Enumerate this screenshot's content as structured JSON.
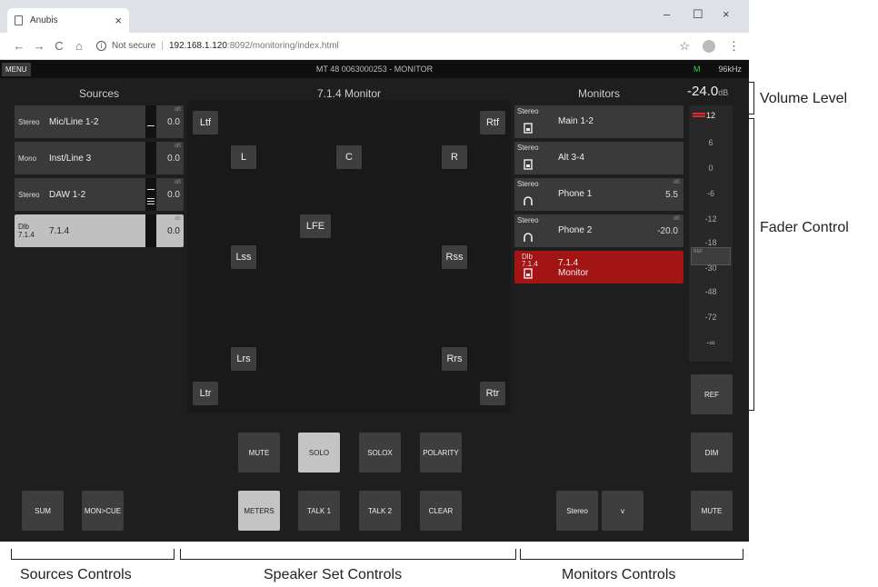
{
  "browser": {
    "tab_title": "Anubis",
    "tab_close": "×",
    "window_controls": [
      "–",
      "☐",
      "×"
    ],
    "nav": [
      "←",
      "→",
      "C",
      "⌂"
    ],
    "security_text": "Not secure",
    "url_host": "192.168.1.120",
    "url_path": ":8092/monitoring/index.html",
    "star_icon": "☆",
    "menu_icon": "⋮"
  },
  "app": {
    "menu_label": "MENU",
    "title": "MT 48 0063000253 - MONITOR",
    "m_indicator": "M",
    "sample_rate": "96kHz",
    "sources_header": "Sources",
    "speaker_header": "7.1.4 Monitor",
    "monitors_header": "Monitors",
    "volume_value": "-24.0",
    "volume_unit": "dB",
    "db_tag": "dB",
    "sources": [
      {
        "kind": "Stereo",
        "name": "Mic/Line 1-2",
        "value": "0.0"
      },
      {
        "kind": "Mono",
        "name": "Inst/Line 3",
        "value": "0.0"
      },
      {
        "kind": "Stereo",
        "name": "DAW 1-2",
        "value": "0.0"
      },
      {
        "kind_line1": "Dlb",
        "kind_line2": "7.1.4",
        "name": "7.1.4",
        "value": "0.0"
      }
    ],
    "speakers": {
      "ltf": "Ltf",
      "rtf": "Rtf",
      "l": "L",
      "c": "C",
      "r": "R",
      "lfe": "LFE",
      "lss": "Lss",
      "rss": "Rss",
      "lrs": "Lrs",
      "rrs": "Rrs",
      "ltr": "Ltr",
      "rtr": "Rtr"
    },
    "monitors": [
      {
        "kind": "Stereo",
        "name": "Main 1-2",
        "value": ""
      },
      {
        "kind": "Stereo",
        "name": "Alt 3-4",
        "value": ""
      },
      {
        "kind": "Stereo",
        "name": "Phone 1",
        "value": "5.5"
      },
      {
        "kind": "Stereo",
        "name": "Phone 2",
        "value": "-20.0"
      },
      {
        "kind_line1": "Dlb",
        "kind_line2": "7.1.4",
        "name_line1": "7.1.4",
        "name_line2": "Monitor"
      }
    ],
    "fader_scale": [
      "12",
      "6",
      "0",
      "-6",
      "-12",
      "-18",
      "-30",
      "-48",
      "-72",
      "-∞"
    ],
    "fader_knob_label": "REF",
    "ref_button": "REF",
    "dim_button": "DIM",
    "mute_master_button": "MUTE",
    "speaker_controls_row1": [
      "MUTE",
      "SOLO",
      "SOLOX",
      "POLARITY"
    ],
    "speaker_controls_row2": [
      "METERS",
      "TALK 1",
      "TALK 2",
      "CLEAR"
    ],
    "source_controls": [
      "SUM",
      "MON>CUE"
    ],
    "monitor_controls": [
      "Stereo",
      "v"
    ]
  },
  "annotations": {
    "volume_level": "Volume Level",
    "fader_control": "Fader Control",
    "sources_controls": "Sources Controls",
    "speaker_set_controls": "Speaker Set Controls",
    "monitors_controls": "Monitors Controls"
  },
  "colors": {
    "app_bg": "#1e1e1e",
    "active_monitor": "#a31515",
    "selected": "#c0c0c0",
    "m_indicator": "#2ecc40"
  }
}
